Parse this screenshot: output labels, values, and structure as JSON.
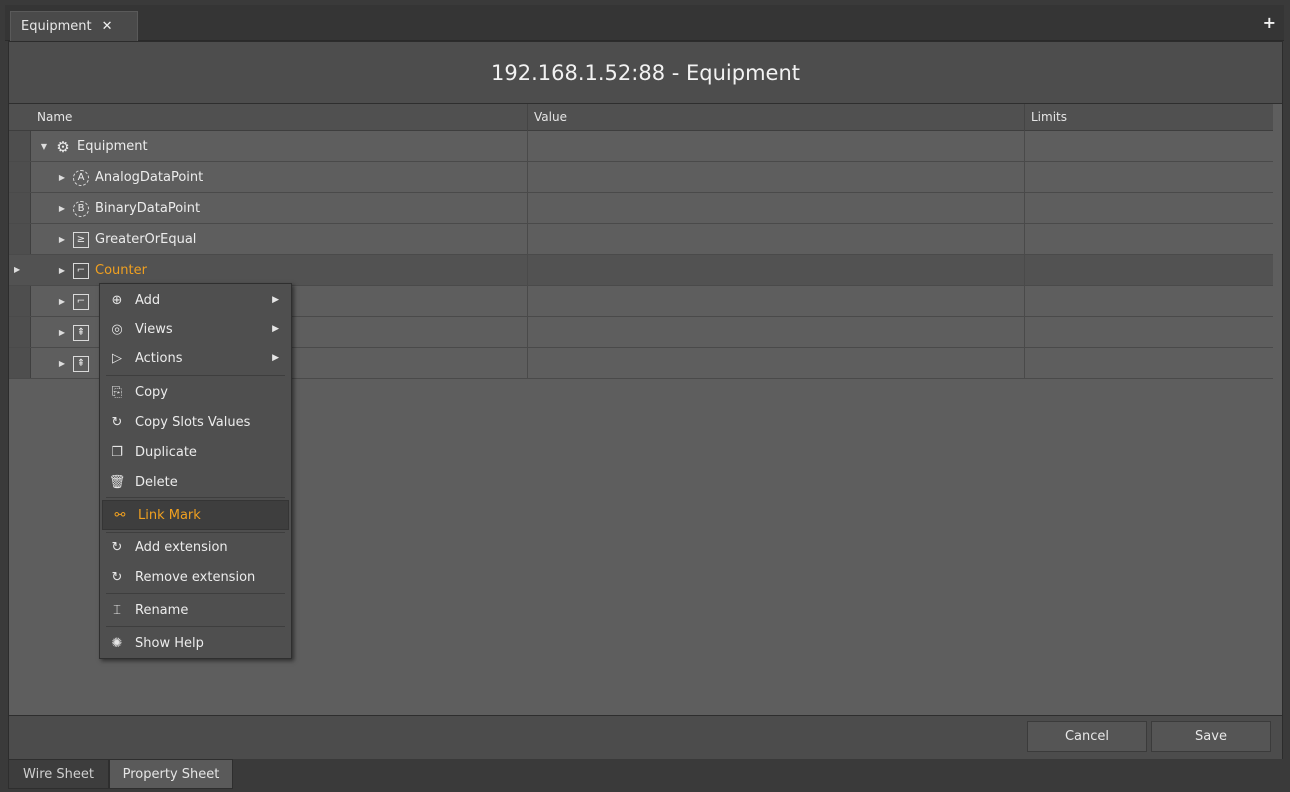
{
  "tab": {
    "title": "Equipment",
    "close": "✕",
    "add": "+"
  },
  "title": "192.168.1.52:88 - Equipment",
  "columns": {
    "name": "Name",
    "value": "Value",
    "limits": "Limits"
  },
  "tree": [
    {
      "label": "Equipment",
      "icon": "gear-icon",
      "glyph": "⚙",
      "expanded": true
    },
    {
      "label": "AnalogDataPoint",
      "icon": "analog-point-icon",
      "glyph": "A"
    },
    {
      "label": "BinaryDataPoint",
      "icon": "binary-point-icon",
      "glyph": "B"
    },
    {
      "label": "GreaterOrEqual",
      "icon": "greater-equal-icon",
      "glyph": "≥"
    },
    {
      "label": "Counter",
      "icon": "counter-icon",
      "glyph": "⌐",
      "selected": true
    },
    {
      "label": "",
      "icon": "counter-icon",
      "glyph": "⌐"
    },
    {
      "label": "",
      "icon": "block-icon",
      "glyph": "⇞"
    },
    {
      "label": "",
      "icon": "block-icon",
      "glyph": "⇞"
    }
  ],
  "context_menu": {
    "add": "Add",
    "views": "Views",
    "actions": "Actions",
    "copy": "Copy",
    "copy_slots": "Copy Slots Values",
    "duplicate": "Duplicate",
    "delete": "Delete",
    "link_mark": "Link Mark",
    "add_extension": "Add extension",
    "remove_extension": "Remove extension",
    "rename": "Rename",
    "show_help": "Show Help"
  },
  "footer": {
    "cancel": "Cancel",
    "save": "Save"
  },
  "bottom_tabs": {
    "wire_sheet": "Wire Sheet",
    "property_sheet": "Property Sheet"
  },
  "colors": {
    "highlight": "#f0a020",
    "background": "#5e5e5e"
  }
}
